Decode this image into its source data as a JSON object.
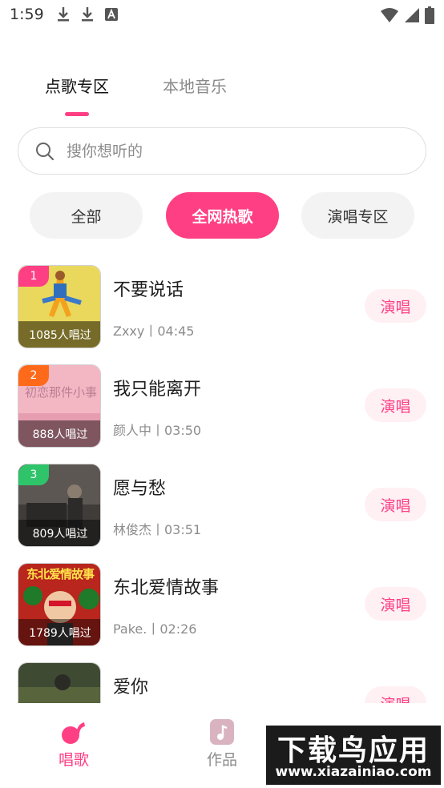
{
  "status_bar": {
    "time": "1:59",
    "left_icons": [
      "download-icon",
      "download-icon",
      "a-icon"
    ],
    "right_icons": [
      "wifi-icon",
      "signal-icon",
      "battery-icon"
    ]
  },
  "tabs": [
    {
      "label": "点歌专区",
      "active": true
    },
    {
      "label": "本地音乐",
      "active": false
    }
  ],
  "search": {
    "placeholder": "搜你想听的",
    "value": ""
  },
  "filters": [
    {
      "label": "全部",
      "active": false
    },
    {
      "label": "全网热歌",
      "active": true
    },
    {
      "label": "演唱专区",
      "active": false
    }
  ],
  "songs": [
    {
      "rank": "1",
      "sung_count": "1085人唱过",
      "title": "不要说话",
      "meta": "Zxxy丨04:45",
      "action": "演唱",
      "badge_color": "#ff3f84"
    },
    {
      "rank": "2",
      "sung_count": "888人唱过",
      "title": "我只能离开",
      "meta": "颜人中丨03:50",
      "action": "演唱",
      "badge_color": "#ff6a1a"
    },
    {
      "rank": "3",
      "sung_count": "809人唱过",
      "title": "愿与愁",
      "meta": "林俊杰丨03:51",
      "action": "演唱",
      "badge_color": "#2fc46a"
    },
    {
      "rank": "",
      "sung_count": "1789人唱过",
      "title": "东北爱情故事",
      "meta": "Pake.丨02:26",
      "action": "演唱",
      "badge_color": ""
    },
    {
      "rank": "",
      "sung_count": "",
      "title": "爱你",
      "meta": "",
      "action": "演唱",
      "badge_color": ""
    }
  ],
  "cover_texts": {
    "song2_cover_text": "初恋那件小事",
    "song4_cover_text": "东北爱情故事"
  },
  "bottom_nav": [
    {
      "label": "唱歌",
      "icon": "music-note-icon",
      "active": true
    },
    {
      "label": "作品",
      "icon": "music-file-icon",
      "active": false
    }
  ],
  "watermark": {
    "title": "下载鸟应用",
    "url": "www.xiazainiao.com"
  },
  "colors": {
    "accent": "#ff3f84",
    "accent_light": "#fff0f4",
    "pill_gray": "#f3f3f3"
  }
}
